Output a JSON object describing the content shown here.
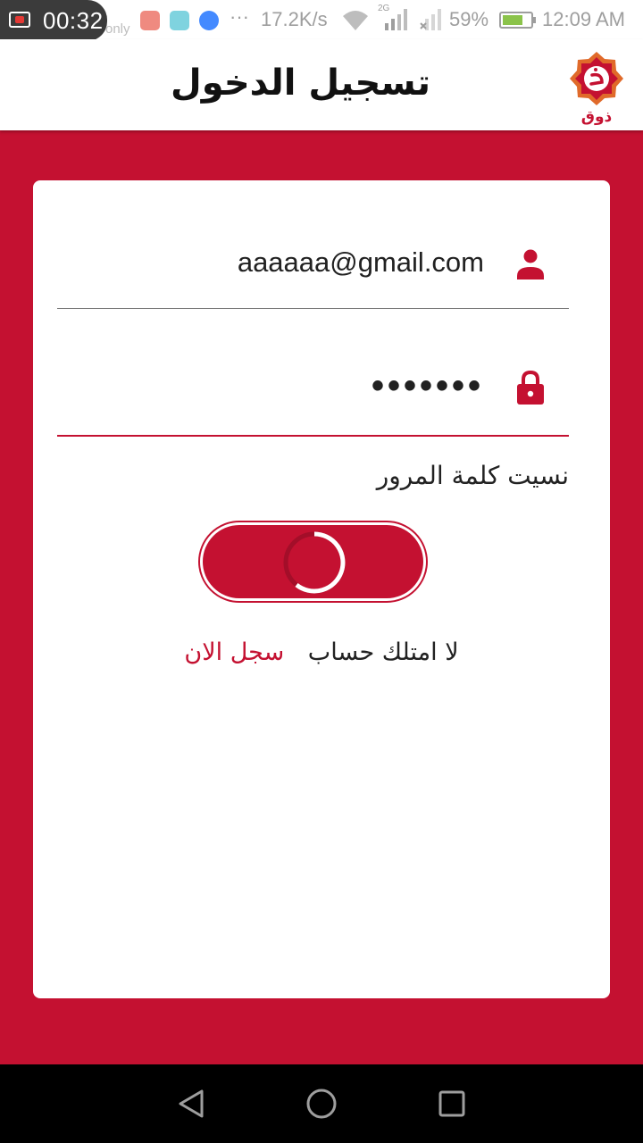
{
  "status_bar": {
    "recording_time": "00:32",
    "carrier_overlay": "only",
    "notification_icons": [
      "screen-recorder-icon",
      "android-icon",
      "messenger-icon"
    ],
    "more_indicator": "···",
    "net_speed": "17.2K/s",
    "network_type": "2G",
    "battery_percent": "59%",
    "clock": "12:09 AM"
  },
  "header": {
    "title": "تسجيل الدخول",
    "logo_icon": "dhawq-logo",
    "logo_text": "ذوق"
  },
  "form": {
    "email_value": "aaaaaa@gmail.com",
    "email_icon": "person-icon",
    "password_value": "•••••••",
    "password_icon": "lock-icon",
    "forgot_password": "نسيت كلمة المرور",
    "login_button_state": "loading",
    "no_account_text": "لا امتلك حساب",
    "signup_link": "سجل الان"
  },
  "nav_bar": {
    "buttons": [
      "back-icon",
      "home-icon",
      "recent-apps-icon"
    ]
  },
  "colors": {
    "primary": "#c41131",
    "background": "#c41131",
    "card": "#ffffff",
    "navbar": "#000000"
  }
}
